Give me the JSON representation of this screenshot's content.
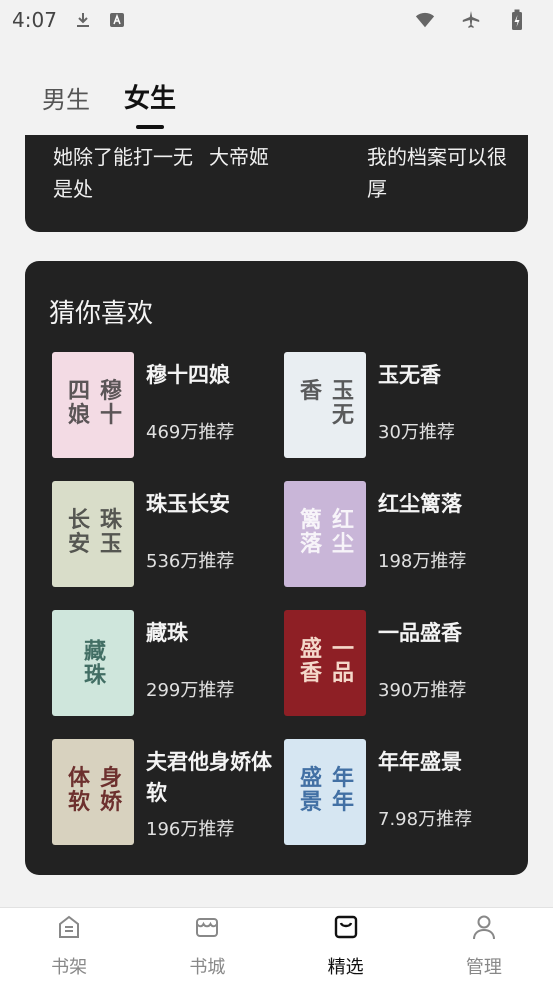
{
  "status_bar": {
    "time": "4:07"
  },
  "tabs": [
    {
      "label": "男生",
      "active": false
    },
    {
      "label": "女生",
      "active": true
    }
  ],
  "top_card": {
    "items": [
      "她除了能打一无是处",
      "大帝姬",
      "我的档案可以很厚"
    ]
  },
  "guess_section": {
    "title": "猜你喜欢",
    "books": [
      {
        "title": "穆十四娘",
        "recommend": "469万推荐",
        "cover_text": "穆十四娘",
        "cover_color": "#f3dbe4"
      },
      {
        "title": "玉无香",
        "recommend": "30万推荐",
        "cover_text": "玉无香",
        "cover_color": "#e9eef2"
      },
      {
        "title": "珠玉长安",
        "recommend": "536万推荐",
        "cover_text": "珠玉长安",
        "cover_color": "#d9ddc9"
      },
      {
        "title": "红尘篱落",
        "recommend": "198万推荐",
        "cover_text": "红尘篱落",
        "cover_color": "#c9b6d8"
      },
      {
        "title": "藏珠",
        "recommend": "299万推荐",
        "cover_text": "藏珠",
        "cover_color": "#cfe6dc"
      },
      {
        "title": "一品盛香",
        "recommend": "390万推荐",
        "cover_text": "一品盛香",
        "cover_color": "#8e1f25"
      },
      {
        "title": "夫君他身娇体软",
        "recommend": "196万推荐",
        "cover_text": "身娇体软",
        "cover_color": "#d8d2bf"
      },
      {
        "title": "年年盛景",
        "recommend": "7.98万推荐",
        "cover_text": "年年盛景",
        "cover_color": "#d6e6f2"
      }
    ]
  },
  "bottom_nav": [
    {
      "label": "书架",
      "icon": "bookshelf-icon",
      "active": false
    },
    {
      "label": "书城",
      "icon": "store-icon",
      "active": false
    },
    {
      "label": "精选",
      "icon": "featured-icon",
      "active": true
    },
    {
      "label": "管理",
      "icon": "user-icon",
      "active": false
    }
  ]
}
